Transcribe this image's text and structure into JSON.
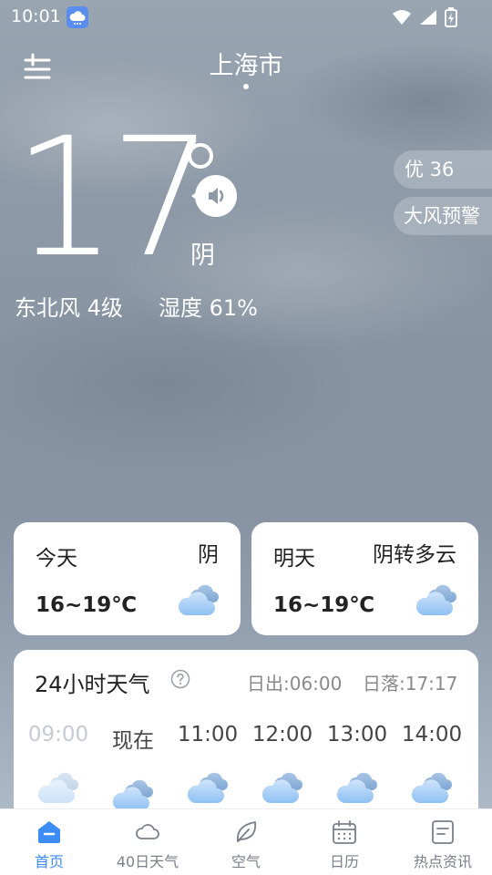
{
  "status_bar": {
    "time": "10:01",
    "app_icon": "weather-app-icon",
    "icons": [
      "wifi-icon",
      "signal-icon",
      "battery-charging-icon"
    ]
  },
  "header": {
    "city": "上海市",
    "menu_icon": "menu-settings-icon"
  },
  "current": {
    "temperature": "17",
    "condition": "阴",
    "wind": "东北风 4级",
    "humidity": "湿度 61%"
  },
  "pills": {
    "aqi": "优 36",
    "warning": "大风预警"
  },
  "forecast_cards": [
    {
      "day": "今天",
      "condition": "阴",
      "range": "16~19℃",
      "icon": "cloudy-icon"
    },
    {
      "day": "明天",
      "condition": "阴转多云",
      "range": "16~19℃",
      "icon": "cloudy-icon"
    }
  ],
  "hourly": {
    "title": "24小时天气",
    "sunrise": "日出:06:00",
    "sunset": "日落:17:17",
    "hours": [
      {
        "label": "09:00",
        "past": true,
        "icon": "cloudy-icon"
      },
      {
        "label": "现在",
        "past": false,
        "icon": "cloudy-icon"
      },
      {
        "label": "11:00",
        "past": false,
        "icon": "cloudy-icon"
      },
      {
        "label": "12:00",
        "past": false,
        "icon": "cloudy-icon"
      },
      {
        "label": "13:00",
        "past": false,
        "icon": "cloudy-icon"
      },
      {
        "label": "14:00",
        "past": false,
        "icon": "cloudy-icon"
      }
    ]
  },
  "bottom_nav": {
    "active": "home",
    "items": [
      {
        "label": "首页",
        "icon": "home-icon"
      },
      {
        "label": "40日天气",
        "icon": "cloud-icon"
      },
      {
        "label": "空气",
        "icon": "leaf-icon"
      },
      {
        "label": "日历",
        "icon": "calendar-icon"
      },
      {
        "label": "热点资讯",
        "icon": "news-icon"
      }
    ]
  },
  "colors": {
    "accent": "#3c8cf6",
    "card_bg": "#ffffff",
    "text_dark": "#222222",
    "text_muted": "#8a8a8a"
  }
}
